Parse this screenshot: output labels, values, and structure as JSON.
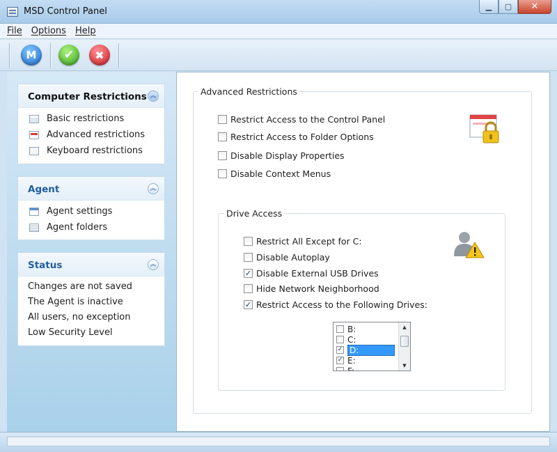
{
  "window": {
    "title": "MSD Control Panel",
    "controls": {
      "minimize": "▁",
      "maximize": "▢",
      "close": "✕"
    }
  },
  "menu": {
    "items": [
      "File",
      "Options",
      "Help"
    ]
  },
  "toolbar": {
    "m_label": "M",
    "apply_glyph": "✔",
    "cancel_glyph": "✖"
  },
  "sidebar": {
    "computer_restrictions": {
      "title": "Computer Restrictions",
      "items": [
        "Basic restrictions",
        "Advanced restrictions",
        "Keyboard restrictions"
      ]
    },
    "agent": {
      "title": "Agent",
      "items": [
        "Agent settings",
        "Agent folders"
      ]
    },
    "status": {
      "title": "Status",
      "lines": [
        "Changes are not saved",
        "The Agent is inactive",
        "All users, no exception",
        "Low Security Level"
      ]
    },
    "collapse_glyph": "︽"
  },
  "advanced": {
    "title": "Advanced Restrictions",
    "options": [
      {
        "label": "Restrict Access to the Control Panel",
        "checked": false
      },
      {
        "label": "Restrict Access to Folder Options",
        "checked": false
      },
      {
        "label": "Disable Display Properties",
        "checked": false
      },
      {
        "label": "Disable Context Menus",
        "checked": false
      }
    ]
  },
  "drive_access": {
    "title": "Drive Access",
    "options": [
      {
        "label": "Restrict All Except for C:",
        "checked": false
      },
      {
        "label": "Disable Autoplay",
        "checked": false
      },
      {
        "label": "Disable External USB Drives",
        "checked": true
      },
      {
        "label": "Hide Network Neighborhood",
        "checked": false
      },
      {
        "label": "Restrict Access to the Following Drives:",
        "checked": true
      }
    ],
    "drives": [
      {
        "label": "B:",
        "checked": false
      },
      {
        "label": "C:",
        "checked": false
      },
      {
        "label": "D:",
        "checked": true,
        "selected": true
      },
      {
        "label": "E:",
        "checked": true
      },
      {
        "label": "F:",
        "checked": false
      }
    ]
  },
  "check_glyph": "✓",
  "colors": {
    "accent": "#1f5fa0",
    "selection": "#3399ff",
    "panel_bg": "#cfe3f3"
  }
}
